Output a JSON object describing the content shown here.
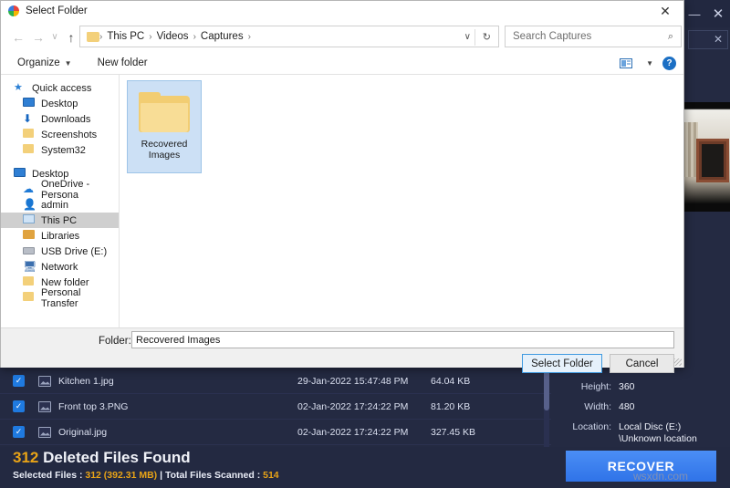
{
  "background_app": {
    "window_controls": {
      "minimize": "—",
      "close": "✕",
      "search_clear": "✕"
    },
    "preview": {
      "name": "image-preview"
    },
    "metadata": [
      {
        "key": "Height:",
        "value": "360"
      },
      {
        "key": "Width:",
        "value": "480"
      },
      {
        "key": "Location:",
        "value": "Local Disc (E:)"
      },
      {
        "key": "",
        "value": "\\Unknown location"
      }
    ],
    "files": [
      {
        "name": "Kitchen 1.jpg",
        "date": "29-Jan-2022 15:47:48 PM",
        "size": "64.04 KB",
        "checked": true
      },
      {
        "name": "Front top 3.PNG",
        "date": "02-Jan-2022 17:24:22 PM",
        "size": "81.20 KB",
        "checked": true
      },
      {
        "name": "Original.jpg",
        "date": "02-Jan-2022 17:24:22 PM",
        "size": "327.45 KB",
        "checked": true
      }
    ],
    "status": {
      "count": "312",
      "title_rest": " Deleted Files Found",
      "sub_prefix": "Selected Files : ",
      "sub_selected": "312 (392.31 MB)",
      "sub_middle": " | Total Files Scanned : ",
      "sub_scanned": "514"
    },
    "recover_label": "RECOVER",
    "watermark": "wsxdn.com",
    "accent_orange": "#e8a317",
    "accent_blue": "#2f73e8"
  },
  "dialog": {
    "title": "Select Folder",
    "close_label": "✕",
    "nav": {
      "back": "←",
      "forward": "→",
      "recent": "∨",
      "up": "↑",
      "breadcrumb": [
        "This PC",
        "Videos",
        "Captures"
      ],
      "separator": "›",
      "caret": "∨",
      "refresh": "↻"
    },
    "search": {
      "placeholder": "Search Captures",
      "icon": "⌕"
    },
    "toolbar": {
      "organize": "Organize",
      "organize_caret": "▼",
      "new_folder": "New folder",
      "view_caret": "▼",
      "help": "?"
    },
    "sidebar": [
      {
        "label": "Quick access",
        "icon": "star-icon",
        "indent": false,
        "selected": false
      },
      {
        "label": "Desktop",
        "icon": "monitor-icon",
        "indent": true,
        "selected": false
      },
      {
        "label": "Downloads",
        "icon": "download-icon",
        "indent": true,
        "selected": false
      },
      {
        "label": "Screenshots",
        "icon": "folder-icon",
        "indent": true,
        "selected": false
      },
      {
        "label": "System32",
        "icon": "folder-icon",
        "indent": true,
        "selected": false
      },
      {
        "label": "Desktop",
        "icon": "monitor-icon",
        "indent": false,
        "selected": false
      },
      {
        "label": "OneDrive - Persona",
        "icon": "cloud-icon",
        "indent": true,
        "selected": false
      },
      {
        "label": "admin",
        "icon": "user-icon",
        "indent": true,
        "selected": false
      },
      {
        "label": "This PC",
        "icon": "pc-icon",
        "indent": true,
        "selected": true
      },
      {
        "label": "Libraries",
        "icon": "library-icon",
        "indent": true,
        "selected": false
      },
      {
        "label": "USB Drive (E:)",
        "icon": "usb-icon",
        "indent": true,
        "selected": false
      },
      {
        "label": "Network",
        "icon": "network-icon",
        "indent": true,
        "selected": false
      },
      {
        "label": "New folder",
        "icon": "folder-icon",
        "indent": true,
        "selected": false
      },
      {
        "label": "Personal Transfer",
        "icon": "folder-icon",
        "indent": true,
        "selected": false
      }
    ],
    "folder_tile": {
      "label": "Recovered\nImages",
      "label_line1": "Recovered",
      "label_line2": "Images"
    },
    "footer": {
      "folder_label": "Folder:",
      "folder_value": "Recovered Images",
      "select_button": "Select Folder",
      "cancel_button": "Cancel"
    }
  }
}
